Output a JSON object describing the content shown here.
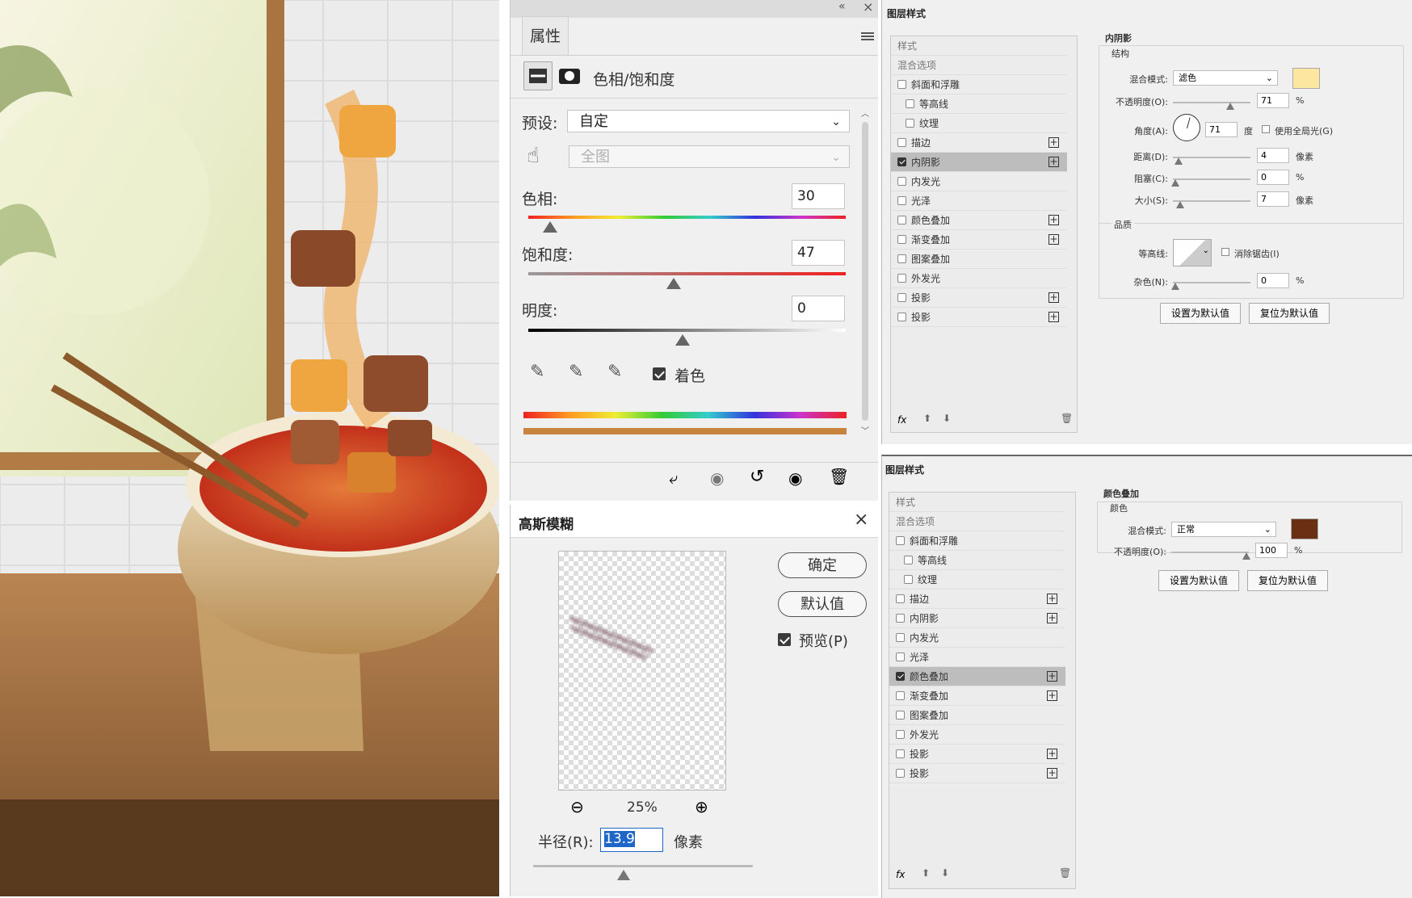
{
  "properties": {
    "tab_label": "属性",
    "adjust_title": "色相/饱和度",
    "preset_label": "预设:",
    "preset_value": "自定",
    "channel_value": "全图",
    "hue_label": "色相:",
    "hue_value": "30",
    "saturation_label": "饱和度:",
    "saturation_value": "47",
    "lightness_label": "明度:",
    "lightness_value": "0",
    "colorize_label": "着色",
    "colorize_checked": true
  },
  "gaussian": {
    "title": "高斯模糊",
    "ok": "确定",
    "default": "默认值",
    "preview_label": "预览(P)",
    "zoom": "25%",
    "radius_label": "半径(R):",
    "radius_value": "13.9",
    "unit": "像素"
  },
  "layer_style_1": {
    "title": "图层样式",
    "list": [
      {
        "label": "样式",
        "type": "header"
      },
      {
        "label": "混合选项",
        "type": "header"
      },
      {
        "label": "斜面和浮雕",
        "checked": false,
        "plus": false,
        "indent": 0
      },
      {
        "label": "等高线",
        "checked": false,
        "plus": false,
        "indent": 1
      },
      {
        "label": "纹理",
        "checked": false,
        "plus": false,
        "indent": 1
      },
      {
        "label": "描边",
        "checked": false,
        "plus": true,
        "indent": 0
      },
      {
        "label": "内阴影",
        "checked": true,
        "plus": true,
        "indent": 0,
        "selected": true
      },
      {
        "label": "内发光",
        "checked": false,
        "plus": false,
        "indent": 0
      },
      {
        "label": "光泽",
        "checked": false,
        "plus": false,
        "indent": 0
      },
      {
        "label": "颜色叠加",
        "checked": false,
        "plus": true,
        "indent": 0
      },
      {
        "label": "渐变叠加",
        "checked": false,
        "plus": true,
        "indent": 0
      },
      {
        "label": "图案叠加",
        "checked": false,
        "plus": false,
        "indent": 0
      },
      {
        "label": "外发光",
        "checked": false,
        "plus": false,
        "indent": 0
      },
      {
        "label": "投影",
        "checked": false,
        "plus": true,
        "indent": 0
      },
      {
        "label": "投影",
        "checked": false,
        "plus": true,
        "indent": 0
      }
    ],
    "section": "内阴影",
    "structure": "结构",
    "blend_label": "混合模式:",
    "blend_value": "滤色",
    "swatch": "#fde7a0",
    "opacity_label": "不透明度(O):",
    "opacity_value": "71",
    "pct": "%",
    "angle_label": "角度(A):",
    "angle_value": "71",
    "deg": "度",
    "global_light": "使用全局光(G)",
    "distance_label": "距离(D):",
    "distance_value": "4",
    "choke_label": "阻塞(C):",
    "choke_value": "0",
    "size_label": "大小(S):",
    "size_value": "7",
    "px": "像素",
    "quality": "品质",
    "contour_label": "等高线:",
    "antialias": "消除锯齿(I)",
    "noise_label": "杂色(N):",
    "noise_value": "0",
    "set_default": "设置为默认值",
    "reset_default": "复位为默认值",
    "fx": "fx"
  },
  "layer_style_2": {
    "title": "图层样式",
    "list": [
      {
        "label": "样式",
        "type": "header"
      },
      {
        "label": "混合选项",
        "type": "header"
      },
      {
        "label": "斜面和浮雕",
        "checked": false,
        "plus": false,
        "indent": 0
      },
      {
        "label": "等高线",
        "checked": false,
        "plus": false,
        "indent": 1
      },
      {
        "label": "纹理",
        "checked": false,
        "plus": false,
        "indent": 1
      },
      {
        "label": "描边",
        "checked": false,
        "plus": true,
        "indent": 0
      },
      {
        "label": "内阴影",
        "checked": false,
        "plus": true,
        "indent": 0
      },
      {
        "label": "内发光",
        "checked": false,
        "plus": false,
        "indent": 0
      },
      {
        "label": "光泽",
        "checked": false,
        "plus": false,
        "indent": 0
      },
      {
        "label": "颜色叠加",
        "checked": true,
        "plus": true,
        "indent": 0,
        "selected": true
      },
      {
        "label": "渐变叠加",
        "checked": false,
        "plus": true,
        "indent": 0
      },
      {
        "label": "图案叠加",
        "checked": false,
        "plus": false,
        "indent": 0
      },
      {
        "label": "外发光",
        "checked": false,
        "plus": false,
        "indent": 0
      },
      {
        "label": "投影",
        "checked": false,
        "plus": true,
        "indent": 0
      },
      {
        "label": "投影",
        "checked": false,
        "plus": true,
        "indent": 0
      }
    ],
    "section": "颜色叠加",
    "color_sub": "颜色",
    "blend_label": "混合模式:",
    "blend_value": "正常",
    "swatch": "#6a3014",
    "opacity_label": "不透明度(O):",
    "opacity_value": "100",
    "pct": "%",
    "set_default": "设置为默认值",
    "reset_default": "复位为默认值",
    "fx": "fx"
  }
}
